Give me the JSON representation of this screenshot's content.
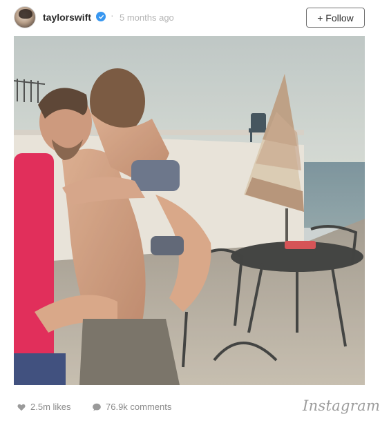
{
  "header": {
    "username": "taylorswift",
    "separator": "·",
    "timestamp": "5 months ago",
    "follow_label": "+ Follow",
    "verified_icon": "verified-badge-icon"
  },
  "post": {
    "photo_description": "",
    "likes": "2.5m likes",
    "comments": "76.9k comments",
    "brand": "Instagram"
  },
  "colors": {
    "verified": "#3897f0",
    "meta_text": "#8a8a8a",
    "timestamp_text": "#b5b5b5"
  }
}
